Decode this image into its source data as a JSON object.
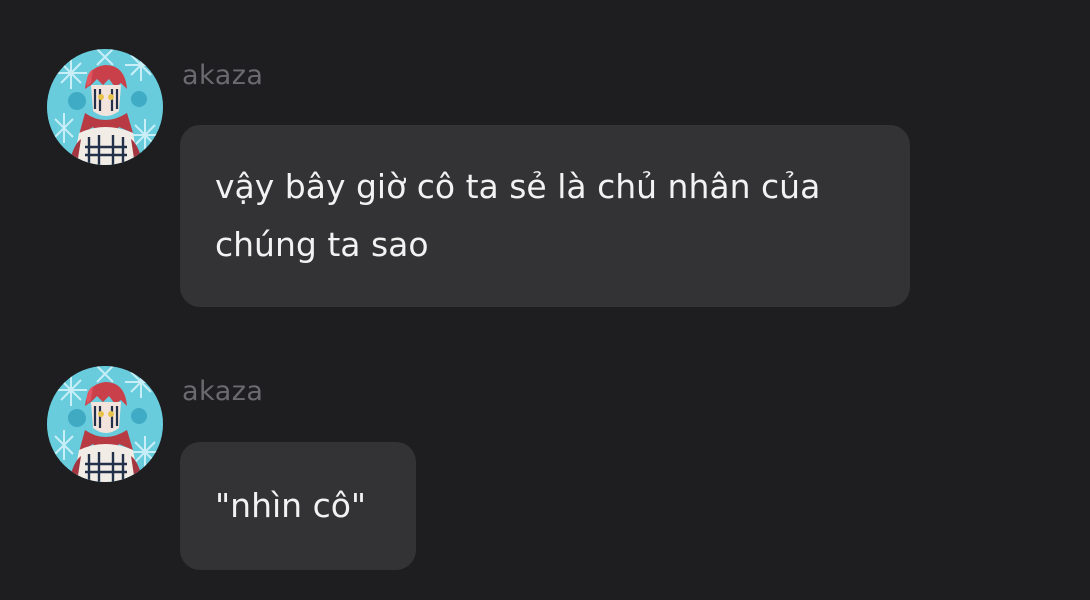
{
  "messages": [
    {
      "username": "akaza",
      "lines": [
        "vậy bây giờ cô ta sẻ là chủ nhân của",
        "chúng ta sao"
      ]
    },
    {
      "username": "akaza",
      "lines": [
        "\"nhìn cô\""
      ]
    }
  ],
  "colors": {
    "background": "#1e1e20",
    "bubble": "#333335",
    "username": "#6b6b6f",
    "text": "#f2f2f2"
  }
}
